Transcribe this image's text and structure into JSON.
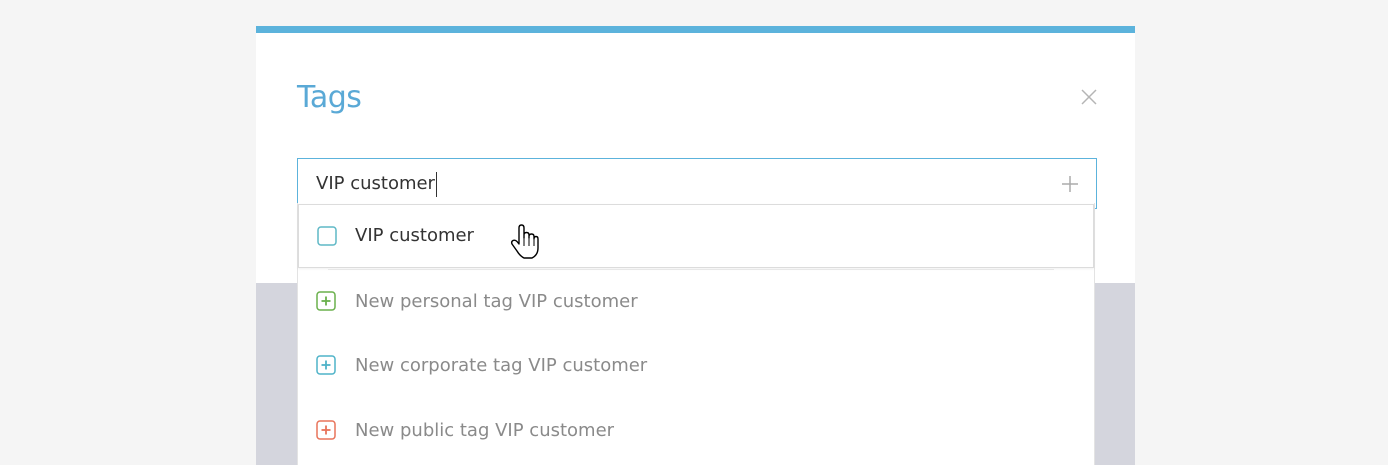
{
  "dialog": {
    "title": "Tags",
    "close_icon": "close-icon",
    "accent_color": "#5cb3dc"
  },
  "input": {
    "value": "VIP customer",
    "add_icon": "plus-icon"
  },
  "dropdown": {
    "items": [
      {
        "label": "VIP customer",
        "icon": "checkbox-icon",
        "icon_color": "#5fb8c6",
        "hovered": true
      },
      {
        "label": "New personal tag VIP customer",
        "icon": "plus-square-icon",
        "icon_color": "#6ab04c"
      },
      {
        "label": "New corporate tag VIP customer",
        "icon": "plus-square-icon",
        "icon_color": "#4fb3c8"
      },
      {
        "label": "New public tag VIP customer",
        "icon": "plus-square-icon",
        "icon_color": "#e8735a"
      }
    ]
  }
}
